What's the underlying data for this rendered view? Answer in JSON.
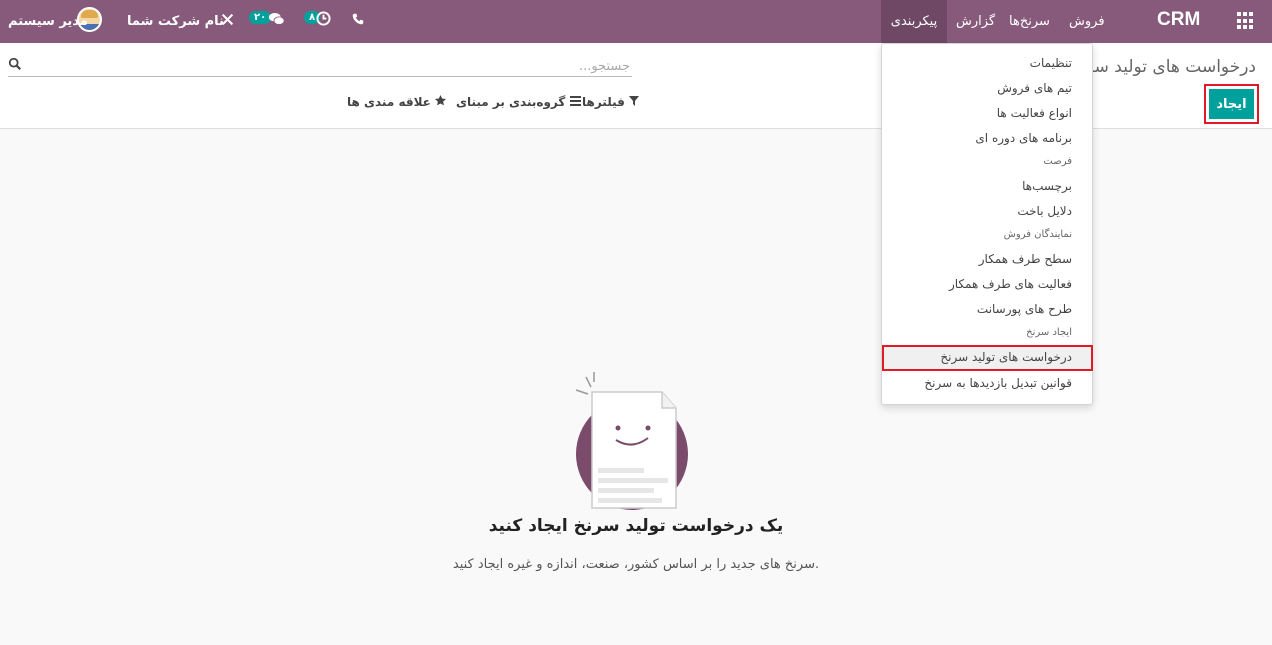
{
  "navbar": {
    "brand": "CRM",
    "menu": [
      {
        "label": "فروش"
      },
      {
        "label": "سرنخ‌ها"
      },
      {
        "label": "گزارش"
      },
      {
        "label": "پیکربندی"
      }
    ],
    "messages_count": "۲۰",
    "activities_count": "۸",
    "company_name": "نام شرکت شما",
    "user_name": "مدیر سیستم"
  },
  "control_panel": {
    "breadcrumb": "درخواست های تولید سرنخ",
    "search_placeholder": "جستجو...",
    "filters_label": "فیلترها",
    "groupby_label": "گروه‌بندی بر مبنای",
    "favorites_label": "علاقه مندی ها",
    "create_label": "ایجاد"
  },
  "dropdown": {
    "items": [
      {
        "type": "item",
        "label": "تنظیمات"
      },
      {
        "type": "item",
        "label": "تیم های فروش"
      },
      {
        "type": "item",
        "label": "انواع فعالیت ها"
      },
      {
        "type": "item",
        "label": "برنامه های دوره ای"
      },
      {
        "type": "header",
        "label": "فرصت"
      },
      {
        "type": "item",
        "label": "برچسب‌ها"
      },
      {
        "type": "item",
        "label": "دلایل باخت"
      },
      {
        "type": "header",
        "label": "نمایندگان فروش"
      },
      {
        "type": "item",
        "label": "سطح طرف همکار"
      },
      {
        "type": "item",
        "label": "فعالیت های طرف همکار"
      },
      {
        "type": "item",
        "label": "طرح های پورسانت"
      },
      {
        "type": "header",
        "label": "ایجاد سرنخ"
      },
      {
        "type": "item",
        "label": "درخواست های تولید سرنخ"
      },
      {
        "type": "item",
        "label": "قوانین تبدیل بازدیدها به سرنخ"
      }
    ]
  },
  "empty_state": {
    "title": "یک درخواست تولید سرنخ ایجاد کنید",
    "description": "سرنخ های جدید را بر اساس کشور، صنعت، اندازه و غیره ایجاد کنید."
  },
  "colors": {
    "navbar": "#875a7b",
    "primary": "#00a09d",
    "highlight": "#e01b24"
  }
}
